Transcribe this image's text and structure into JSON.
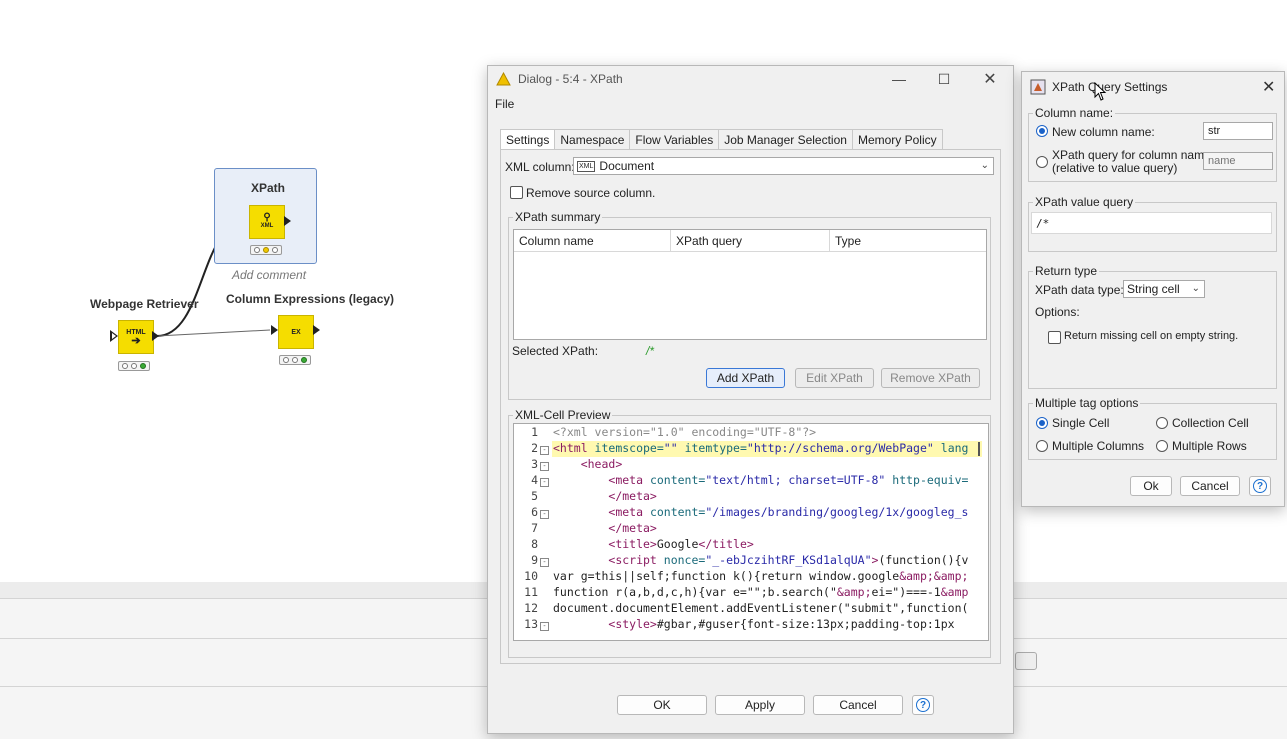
{
  "workflow": {
    "nodes": {
      "xpath": {
        "label": "XPath",
        "icon_text": "XML",
        "comment": "Add comment"
      },
      "webpage_retriever": {
        "label": "Webpage Retriever",
        "icon_text": "HTML"
      },
      "column_expressions": {
        "label": "Column Expressions (legacy)",
        "icon_text": "EX"
      }
    }
  },
  "dialog": {
    "title": "Dialog - 5:4 - XPath",
    "menu": {
      "file": "File"
    },
    "tabs": [
      "Settings",
      "Namespace",
      "Flow Variables",
      "Job Manager Selection",
      "Memory Policy"
    ],
    "xml_column_label": "XML column:",
    "xml_column_value": "Document",
    "remove_source_label": "Remove source column.",
    "xpath_summary": {
      "legend": "XPath summary",
      "headers": [
        "Column name",
        "XPath query",
        "Type"
      ],
      "selected_label": "Selected XPath:",
      "selected_value": "/*",
      "buttons": {
        "add": "Add XPath",
        "edit": "Edit XPath",
        "remove": "Remove XPath"
      }
    },
    "preview": {
      "legend": "XML-Cell Preview",
      "lines": [
        {
          "n": "1",
          "fold": false,
          "indent": 0,
          "tokens": [
            {
              "c": "c-pi",
              "t": "<?xml version=\"1.0\" encoding=\"UTF-8\"?>"
            }
          ]
        },
        {
          "n": "2",
          "fold": true,
          "indent": 0,
          "hl": true,
          "tokens": [
            {
              "c": "c-tag",
              "t": "<html "
            },
            {
              "c": "c-attr",
              "t": "itemscope="
            },
            {
              "c": "c-val",
              "t": "\"\" "
            },
            {
              "c": "c-attr",
              "t": "itemtype="
            },
            {
              "c": "c-val",
              "t": "\"http://schema.org/WebPage\" "
            },
            {
              "c": "c-attr",
              "t": "lang"
            }
          ]
        },
        {
          "n": "3",
          "fold": true,
          "indent": 4,
          "tokens": [
            {
              "c": "c-tag",
              "t": "<head>"
            }
          ]
        },
        {
          "n": "4",
          "fold": true,
          "indent": 8,
          "tokens": [
            {
              "c": "c-tag",
              "t": "<meta "
            },
            {
              "c": "c-attr",
              "t": "content="
            },
            {
              "c": "c-val",
              "t": "\"text/html; charset=UTF-8\" "
            },
            {
              "c": "c-attr",
              "t": "http-equiv="
            }
          ]
        },
        {
          "n": "5",
          "fold": false,
          "indent": 8,
          "tokens": [
            {
              "c": "c-tag",
              "t": "</meta>"
            }
          ]
        },
        {
          "n": "6",
          "fold": true,
          "indent": 8,
          "tokens": [
            {
              "c": "c-tag",
              "t": "<meta "
            },
            {
              "c": "c-attr",
              "t": "content="
            },
            {
              "c": "c-val",
              "t": "\"/images/branding/googleg/1x/googleg_s"
            }
          ]
        },
        {
          "n": "7",
          "fold": false,
          "indent": 8,
          "tokens": [
            {
              "c": "c-tag",
              "t": "</meta>"
            }
          ]
        },
        {
          "n": "8",
          "fold": false,
          "indent": 8,
          "tokens": [
            {
              "c": "c-tag",
              "t": "<title>"
            },
            {
              "c": "",
              "t": "Google"
            },
            {
              "c": "c-tag",
              "t": "</title>"
            }
          ]
        },
        {
          "n": "9",
          "fold": true,
          "indent": 8,
          "tokens": [
            {
              "c": "c-tag",
              "t": "<script "
            },
            {
              "c": "c-attr",
              "t": "nonce="
            },
            {
              "c": "c-val",
              "t": "\"_-ebJczihtRF_KSd1alqUA\""
            },
            {
              "c": "c-tag",
              "t": ">"
            },
            {
              "c": "",
              "t": "(function(){v"
            }
          ]
        },
        {
          "n": "10",
          "fold": false,
          "indent": 0,
          "tokens": [
            {
              "c": "",
              "t": "var g=this||self;function k(){return window.google"
            },
            {
              "c": "c-ent",
              "t": "&amp;&amp;"
            }
          ]
        },
        {
          "n": "11",
          "fold": false,
          "indent": 0,
          "tokens": [
            {
              "c": "",
              "t": "function r(a,b,d,c,h){var e=\"\";b.search(\""
            },
            {
              "c": "c-ent",
              "t": "&amp;"
            },
            {
              "c": "",
              "t": "ei=\")===-1"
            },
            {
              "c": "c-ent",
              "t": "&amp"
            }
          ]
        },
        {
          "n": "12",
          "fold": false,
          "indent": 0,
          "tokens": [
            {
              "c": "",
              "t": "document.documentElement.addEventListener(\"submit\",function("
            }
          ]
        },
        {
          "n": "13",
          "fold": true,
          "indent": 8,
          "tokens": [
            {
              "c": "c-tag",
              "t": "<style>"
            },
            {
              "c": "",
              "t": "#gbar,#guser{font-size:13px;padding-top:1px "
            }
          ]
        }
      ]
    },
    "buttons": {
      "ok": "OK",
      "apply": "Apply",
      "cancel": "Cancel"
    }
  },
  "query_settings": {
    "title": "XPath Query Settings",
    "column_name": {
      "legend": "Column name:",
      "new_label": "New column name:",
      "new_value": "str",
      "xpath_label_1": "XPath query for column name:",
      "xpath_label_2": "(relative to value query)",
      "xpath_placeholder": "name"
    },
    "value_query": {
      "legend": "XPath value query",
      "value": "/*"
    },
    "return_type": {
      "legend": "Return type",
      "data_type_label": "XPath data type:",
      "data_type_value": "String cell",
      "options_label": "Options:",
      "missing_label": "Return missing cell on empty string."
    },
    "multi_tag": {
      "legend": "Multiple tag options",
      "single": "Single Cell",
      "collection": "Collection Cell",
      "multi_cols": "Multiple Columns",
      "multi_rows": "Multiple Rows"
    },
    "buttons": {
      "ok": "Ok",
      "cancel": "Cancel"
    }
  }
}
